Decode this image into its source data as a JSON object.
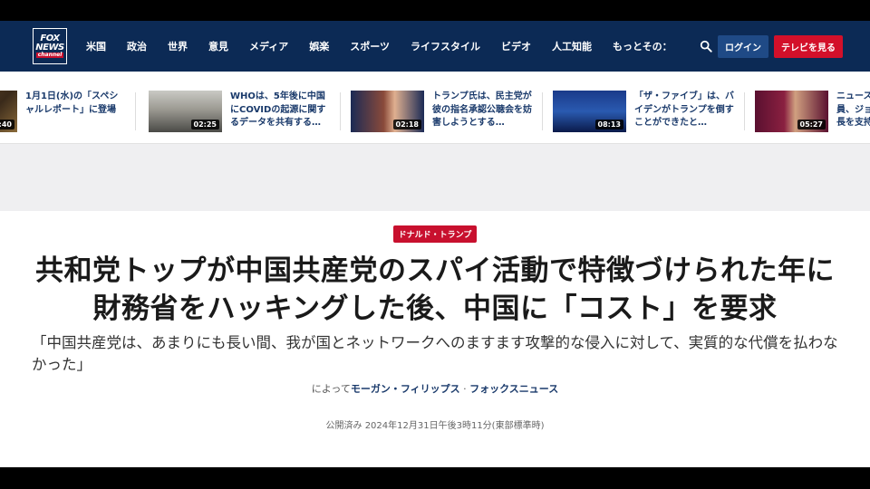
{
  "nav": {
    "logo": {
      "line1": "FOX",
      "line2": "NEWS",
      "line3": "channel"
    },
    "items": [
      "米国",
      "政治",
      "世界",
      "意見",
      "メディア",
      "娯楽",
      "スポーツ",
      "ライフスタイル",
      "ビデオ",
      "人工知能",
      "もっとその："
    ],
    "login_label": "ログイン",
    "tv_label": "テレビを見る"
  },
  "videos": [
    {
      "title": "1月1日(水)の「スペシャルレポート」に登場",
      "duration": ":40"
    },
    {
      "title": "WHOは、5年後に中国にCOVIDの起源に関するデータを共有する…",
      "duration": "02:25"
    },
    {
      "title": "トランプ氏は、民主党が彼の指名承認公聴会を妨害しようとする…",
      "duration": "02:18"
    },
    {
      "title": "「ザ・ファイブ」は、バイデンがトランプを倒すことができたと…",
      "duration": "08:13"
    },
    {
      "title": "ニュース員、ジョ長を支持",
      "duration": "05:27"
    }
  ],
  "article": {
    "tag": "ドナルド・トランプ",
    "headline": "共和党トップが中国共産党のスパイ活動で特徴づけられた年に財務省をハッキングした後、中国に「コスト」を要求",
    "subhead": "「中国共産党は、あまりにも長い間、我が国とネットワークへのますます攻撃的な侵入に対して、実質的な代償を払わなかった」",
    "byline_prefix": "によって",
    "author": "モーガン・フィリップス",
    "byline_sep": " · ",
    "outlet": "フォックスニュース",
    "published": "公開済み 2024年12月31日午後3時11分(東部標準時)"
  },
  "colors": {
    "nav_bg": "#0c2a55",
    "accent_red": "#c8102e",
    "link_blue": "#1a3a6b"
  }
}
